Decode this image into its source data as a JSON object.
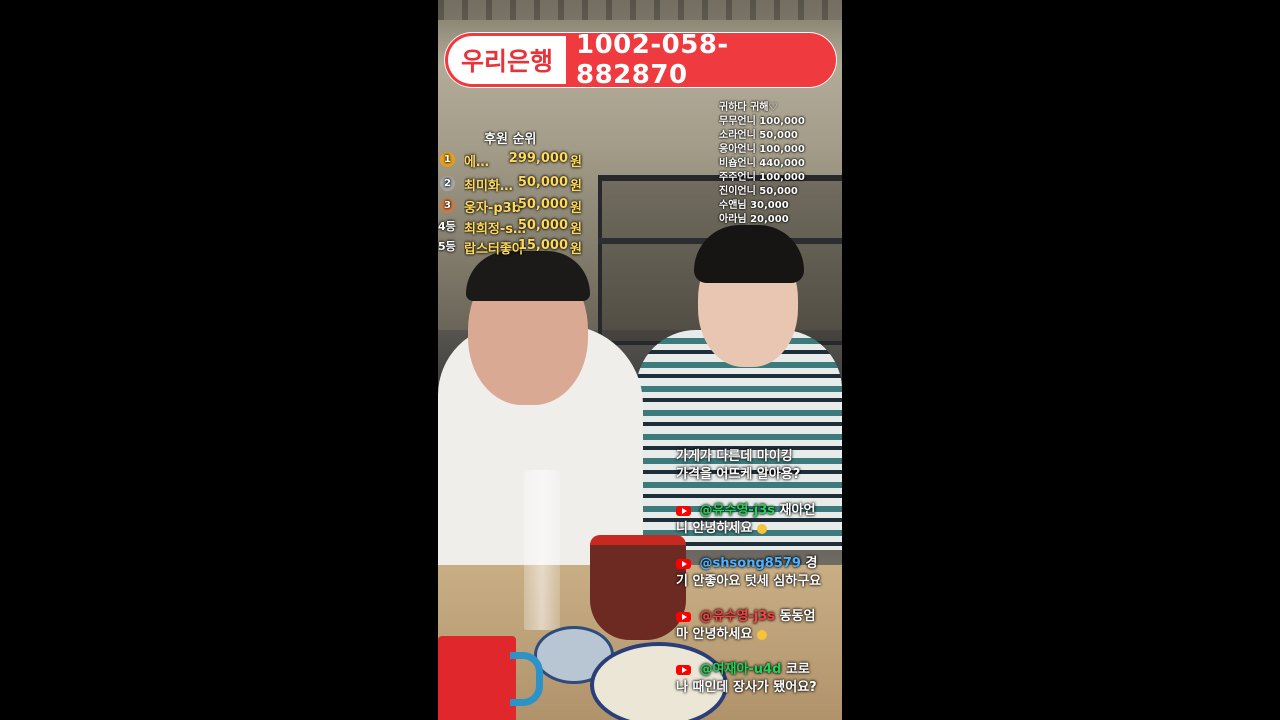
{
  "bank": {
    "name": "우리은행",
    "account": "1002-058-882870"
  },
  "ranking": {
    "title": "후원 순위",
    "rows": [
      {
        "pos": "1",
        "name": "에…",
        "amount": "299,000",
        "unit": "원",
        "medal_color": "#e6a21a"
      },
      {
        "pos": "2",
        "name": "최미화…",
        "amount": "50,000",
        "unit": "원",
        "medal_color": "#a7a7a7"
      },
      {
        "pos": "3",
        "name": "웅자-p3b",
        "amount": "50,000",
        "unit": "원",
        "medal_color": "#c97b4a"
      },
      {
        "pos": "4등",
        "name": "최희정-s…",
        "amount": "50,000",
        "unit": "원"
      },
      {
        "pos": "5등",
        "name": "랍스터좋아",
        "amount": "15,000",
        "unit": "원"
      }
    ]
  },
  "donors": [
    "귀하다 귀해♡",
    "무무언니 100,000",
    "소라언니 50,000",
    "응아언니 100,000",
    "비숍언니 440,000",
    "주주언니 100,000",
    "진이언니 50,000",
    "수앤님 30,000",
    "아라님 20,000"
  ],
  "chat": [
    {
      "user": "",
      "line1": "가게가 다른데 마이킹",
      "line2": "가격을 어뜨케 알아용?"
    },
    {
      "user": "@유수영-j3s",
      "text1": "재아언",
      "line2": "니 안녕하세요",
      "user_color": "green"
    },
    {
      "user": "@shsong8579",
      "text1": "경",
      "line2": "기 안좋아요 텃세 심하구요",
      "user_color": "blue"
    },
    {
      "user": "@유수영-j3s",
      "text1": "동동엄",
      "line2": "마 안녕하세요",
      "user_color": "red"
    },
    {
      "user": "@여재아-u4d",
      "text1": "코로",
      "line2": "나 때인데 장사가 됐어요?",
      "user_color": "green"
    }
  ],
  "icons": {
    "youtube": "youtube-icon",
    "emoji": "smile-emoji-icon"
  }
}
